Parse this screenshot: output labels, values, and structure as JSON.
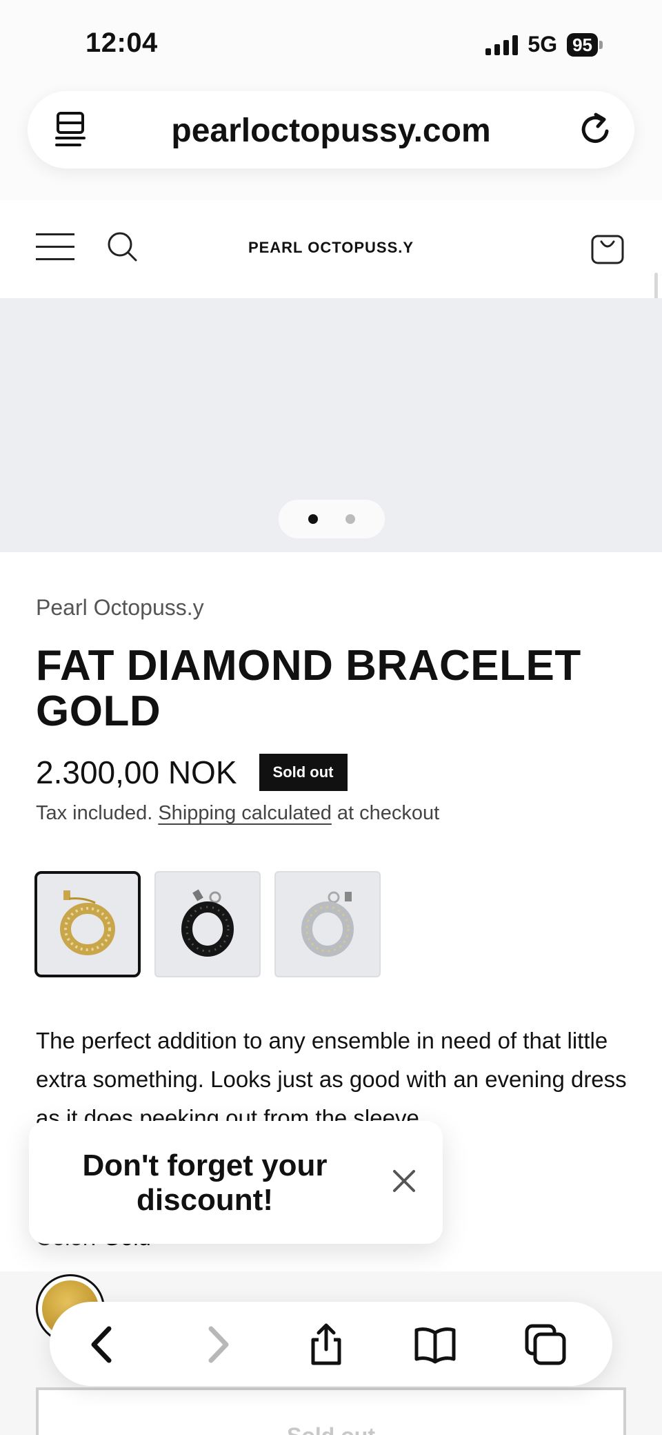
{
  "status_bar": {
    "time": "12:04",
    "network": "5G",
    "battery": "95"
  },
  "browser": {
    "url": "pearloctopussy.com",
    "reader_icon": "reader-icon",
    "reload_icon": "reload-icon"
  },
  "store": {
    "logo": "PEARL OCTOPUSS.Y",
    "menu_icon": "menu-icon",
    "search_icon": "search-icon",
    "cart_icon": "cart-icon"
  },
  "gallery": {
    "slides": 2,
    "active_slide": 1
  },
  "product": {
    "vendor": "Pearl Octopuss.y",
    "title": "FAT DIAMOND BRACELET GOLD",
    "price": "2.300,00 NOK",
    "badge": "Sold out",
    "tax_prefix": "Tax included.",
    "shipping_link": "Shipping calculated",
    "tax_suffix": "at checkout",
    "description": "The perfect addition to any ensemble in need of that little extra something. Looks just as good with an evening dress as it does peeking out from the sleeve",
    "color_label": "Color:",
    "color_value": "Gold",
    "buy_button": "Sold out",
    "variants": [
      {
        "name": "Gold",
        "selected": true,
        "color": "#c9a64a"
      },
      {
        "name": "Black",
        "selected": false,
        "color": "#151515"
      },
      {
        "name": "Silver",
        "selected": false,
        "color": "#b9bcc0"
      }
    ]
  },
  "popup": {
    "text": "Don't forget your discount!",
    "close_icon": "close-icon"
  },
  "toolbar": {
    "back_icon": "chevron-left-icon",
    "forward_icon": "chevron-right-icon",
    "share_icon": "share-icon",
    "bookmarks_icon": "book-icon",
    "tabs_icon": "tabs-icon"
  },
  "colors": {
    "accent": "#111111",
    "gallery_bg": "#eceef1",
    "muted_text": "#555555"
  }
}
